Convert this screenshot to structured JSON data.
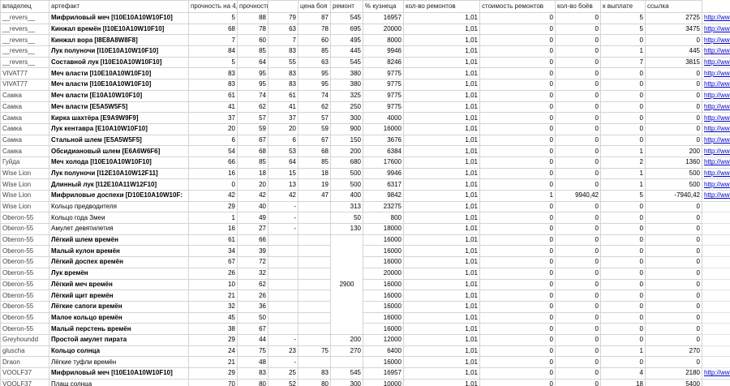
{
  "headers": [
    "владелец",
    "артефакт",
    "прочность на 4,09 22:2",
    "прочность на",
    "",
    "цена боя",
    "ремонт",
    "% кузнеца",
    "кол-во ремонтов",
    "стоимость ремонтов",
    "кол-во боёв",
    "к выплате",
    "ссылка"
  ],
  "merged_price": "2900",
  "rows": [
    {
      "owner": "__revers__",
      "art": "Мифриловый меч [I10E10A10W10F10]",
      "bold": true,
      "d1": "5",
      "d2": "88",
      "p1": "79",
      "p2": "87",
      "price": "545",
      "repair": "16957",
      "pct": "1,01",
      "nrep": "0",
      "cost": "0",
      "fights": "5",
      "pay": "2725",
      "link": "http://www.heroeswm"
    },
    {
      "owner": "__revers__",
      "art": "Кинжал времён [I10E10A10W10F10]",
      "bold": true,
      "d1": "68",
      "d2": "78",
      "p1": "63",
      "p2": "78",
      "price": "695",
      "repair": "20000",
      "pct": "1,01",
      "nrep": "0",
      "cost": "0",
      "fights": "5",
      "pay": "3475",
      "link": "http://www.heroeswm"
    },
    {
      "owner": "__revers__",
      "art": "Кинжал вора [I8E8A8W8F8]",
      "bold": true,
      "d1": "7",
      "d2": "60",
      "p1": "7",
      "p2": "60",
      "price": "495",
      "repair": "8000",
      "pct": "1,01",
      "nrep": "0",
      "cost": "0",
      "fights": "0",
      "pay": "0",
      "link": "http://www.heroeswm"
    },
    {
      "owner": "__revers__",
      "art": "Лук полуночи [I10E10A10W10F10]",
      "bold": true,
      "d1": "84",
      "d2": "85",
      "p1": "83",
      "p2": "85",
      "price": "445",
      "repair": "9946",
      "pct": "1,01",
      "nrep": "0",
      "cost": "0",
      "fights": "1",
      "pay": "445",
      "link": "http://www.heroeswm"
    },
    {
      "owner": "__revers__",
      "art": "Составной лук [I10E10A10W10F10]",
      "bold": true,
      "d1": "5",
      "d2": "64",
      "p1": "55",
      "p2": "63",
      "price": "545",
      "repair": "8246",
      "pct": "1,01",
      "nrep": "0",
      "cost": "0",
      "fights": "7",
      "pay": "3815",
      "link": "http://www.heroeswm"
    },
    {
      "owner": "VIVAT77",
      "art": "Меч власти [I10E10A10W10F10]",
      "bold": true,
      "d1": "83",
      "d2": "95",
      "p1": "83",
      "p2": "95",
      "price": "380",
      "repair": "9775",
      "pct": "1,01",
      "nrep": "0",
      "cost": "0",
      "fights": "0",
      "pay": "0",
      "link": "http://www.heroeswm"
    },
    {
      "owner": "VIVAT77",
      "art": "Меч власти [I10E10A10W10F10]",
      "bold": true,
      "d1": "83",
      "d2": "95",
      "p1": "83",
      "p2": "95",
      "price": "380",
      "repair": "9775",
      "pct": "1,01",
      "nrep": "0",
      "cost": "0",
      "fights": "0",
      "pay": "0",
      "link": "http://www.heroeswm"
    },
    {
      "owner": "Самка",
      "art": "Меч власти [E10A10W10F10]",
      "bold": true,
      "d1": "61",
      "d2": "74",
      "p1": "61",
      "p2": "74",
      "price": "325",
      "repair": "9775",
      "pct": "1,01",
      "nrep": "0",
      "cost": "0",
      "fights": "0",
      "pay": "0",
      "link": "http://www.heroeswm"
    },
    {
      "owner": "Самка",
      "art": "Меч власти [E5A5W5F5]",
      "bold": true,
      "d1": "41",
      "d2": "62",
      "p1": "41",
      "p2": "62",
      "price": "250",
      "repair": "9775",
      "pct": "1,01",
      "nrep": "0",
      "cost": "0",
      "fights": "0",
      "pay": "0",
      "link": "http://www.heroeswm"
    },
    {
      "owner": "Самка",
      "art": "Кирка шахтёра [E9A9W9F9]",
      "bold": true,
      "d1": "37",
      "d2": "57",
      "p1": "37",
      "p2": "57",
      "price": "300",
      "repair": "4000",
      "pct": "1,01",
      "nrep": "0",
      "cost": "0",
      "fights": "0",
      "pay": "0",
      "link": "http://www.heroeswm"
    },
    {
      "owner": "Самка",
      "art": "Лук кентавра [E10A10W10F10]",
      "bold": true,
      "d1": "20",
      "d2": "59",
      "p1": "20",
      "p2": "59",
      "price": "900",
      "repair": "16000",
      "pct": "1,01",
      "nrep": "0",
      "cost": "0",
      "fights": "0",
      "pay": "0",
      "link": "http://www.heroeswm"
    },
    {
      "owner": "Самка",
      "art": "Стальной шлем [E5A5W5F5]",
      "bold": true,
      "d1": "6",
      "d2": "67",
      "p1": "6",
      "p2": "67",
      "price": "150",
      "repair": "3676",
      "pct": "1,01",
      "nrep": "0",
      "cost": "0",
      "fights": "0",
      "pay": "0",
      "link": "http://www.heroeswm"
    },
    {
      "owner": "Самка",
      "art": "Обсидиановый шлем [E6A6W6F6]",
      "bold": true,
      "d1": "54",
      "d2": "68",
      "p1": "53",
      "p2": "68",
      "price": "200",
      "repair": "6384",
      "pct": "1,01",
      "nrep": "0",
      "cost": "0",
      "fights": "1",
      "pay": "200",
      "link": "http://www.heroeswm"
    },
    {
      "owner": "Гуйда",
      "art": "Меч холода [I10E10A10W10F10]",
      "bold": true,
      "d1": "66",
      "d2": "85",
      "p1": "64",
      "p2": "85",
      "price": "680",
      "repair": "17600",
      "pct": "1,01",
      "nrep": "0",
      "cost": "0",
      "fights": "2",
      "pay": "1360",
      "link": "http://www.heroeswm"
    },
    {
      "owner": "Wise Lion",
      "art": "Лук полуночи [I12E10A10W12F11]",
      "bold": true,
      "d1": "16",
      "d2": "18",
      "p1": "15",
      "p2": "18",
      "price": "500",
      "repair": "9946",
      "pct": "1,01",
      "nrep": "0",
      "cost": "0",
      "fights": "1",
      "pay": "500",
      "link": "http://www.heroeswm"
    },
    {
      "owner": "Wise Lion",
      "art": "Длинный лук [I12E10A11W12F10]",
      "bold": true,
      "d1": "0",
      "d2": "20",
      "p1": "13",
      "p2": "19",
      "price": "500",
      "repair": "6317",
      "pct": "1,01",
      "nrep": "0",
      "cost": "0",
      "fights": "1",
      "pay": "500",
      "link": "http://www.heroeswm"
    },
    {
      "owner": "Wise Lion",
      "art": "Мифриловые доспехи [D10E10A10W10F:",
      "bold": true,
      "d1": "42",
      "d2": "42",
      "p1": "42",
      "p2": "47",
      "price": "400",
      "repair": "9842",
      "pct": "1,01",
      "nrep": "1",
      "cost": "9940,42",
      "fights": "5",
      "pay": "-7940,42",
      "link": "http://www.heroeswm"
    },
    {
      "owner": "Wise Lion",
      "art": "Кольцо предводителя",
      "bold": false,
      "d1": "29",
      "d2": "40",
      "p1": "-",
      "p2": "",
      "price": "313",
      "repair": "23275",
      "pct": "1,01",
      "nrep": "0",
      "cost": "0",
      "fights": "0",
      "pay": "0",
      "link": ""
    },
    {
      "owner": "Oberon-55",
      "art": "Кольцо года Змеи",
      "bold": false,
      "d1": "1",
      "d2": "49",
      "p1": "-",
      "p2": "",
      "price": "50",
      "repair": "800",
      "pct": "1,01",
      "nrep": "0",
      "cost": "0",
      "fights": "0",
      "pay": "0",
      "link": ""
    },
    {
      "owner": "Oberon-55",
      "art": "Амулет девятилетия",
      "bold": false,
      "d1": "16",
      "d2": "27",
      "p1": "-",
      "p2": "",
      "price": "130",
      "repair": "18000",
      "pct": "1,01",
      "nrep": "0",
      "cost": "0",
      "fights": "0",
      "pay": "0",
      "link": ""
    },
    {
      "owner": "Oberon-55",
      "art": "Лёгкий шлем времён",
      "bold": true,
      "d1": "61",
      "d2": "66",
      "p1": "",
      "p2": "",
      "price": "",
      "repair": "16000",
      "pct": "1,01",
      "nrep": "0",
      "cost": "0",
      "fights": "0",
      "pay": "0",
      "link": ""
    },
    {
      "owner": "Oberon-55",
      "art": "Малый кулон времён",
      "bold": true,
      "d1": "34",
      "d2": "39",
      "p1": "",
      "p2": "",
      "price": "",
      "repair": "16000",
      "pct": "1,01",
      "nrep": "0",
      "cost": "0",
      "fights": "0",
      "pay": "0",
      "link": ""
    },
    {
      "owner": "Oberon-55",
      "art": "Лёгкий доспех времён",
      "bold": true,
      "d1": "67",
      "d2": "72",
      "p1": "",
      "p2": "",
      "price": "",
      "repair": "16000",
      "pct": "1,01",
      "nrep": "0",
      "cost": "0",
      "fights": "0",
      "pay": "0",
      "link": ""
    },
    {
      "owner": "Oberon-55",
      "art": "Лук времён",
      "bold": true,
      "d1": "26",
      "d2": "32",
      "p1": "",
      "p2": "",
      "price": "",
      "repair": "20000",
      "pct": "1,01",
      "nrep": "0",
      "cost": "0",
      "fights": "0",
      "pay": "0",
      "link": ""
    },
    {
      "owner": "Oberon-55",
      "art": "Лёгкий меч времён",
      "bold": true,
      "d1": "10",
      "d2": "62",
      "p1": "",
      "p2": "",
      "price": "",
      "repair": "16000",
      "pct": "1,01",
      "nrep": "0",
      "cost": "0",
      "fights": "0",
      "pay": "0",
      "link": ""
    },
    {
      "owner": "Oberon-55",
      "art": "Лёгкий щит времён",
      "bold": true,
      "d1": "21",
      "d2": "26",
      "p1": "",
      "p2": "",
      "price": "",
      "repair": "16000",
      "pct": "1,01",
      "nrep": "0",
      "cost": "0",
      "fights": "0",
      "pay": "0",
      "link": ""
    },
    {
      "owner": "Oberon-55",
      "art": "Лёгкие сапоги времён",
      "bold": true,
      "d1": "32",
      "d2": "36",
      "p1": "",
      "p2": "",
      "price": "",
      "repair": "16000",
      "pct": "1,01",
      "nrep": "0",
      "cost": "0",
      "fights": "0",
      "pay": "0",
      "link": ""
    },
    {
      "owner": "Oberon-55",
      "art": "Малое кольцо времён",
      "bold": true,
      "d1": "45",
      "d2": "50",
      "p1": "",
      "p2": "",
      "price": "",
      "repair": "16000",
      "pct": "1,01",
      "nrep": "0",
      "cost": "0",
      "fights": "0",
      "pay": "0",
      "link": ""
    },
    {
      "owner": "Oberon-55",
      "art": "Малый перстень времён",
      "bold": true,
      "d1": "38",
      "d2": "67",
      "p1": "",
      "p2": "",
      "price": "",
      "repair": "16000",
      "pct": "1,01",
      "nrep": "0",
      "cost": "0",
      "fights": "0",
      "pay": "0",
      "link": ""
    },
    {
      "owner": "Greyhoundd",
      "art": "Простой амулет пирата",
      "bold": true,
      "d1": "29",
      "d2": "44",
      "p1": "-",
      "p2": "",
      "price": "200",
      "repair": "12000",
      "pct": "1,01",
      "nrep": "0",
      "cost": "0",
      "fights": "0",
      "pay": "0",
      "link": ""
    },
    {
      "owner": "gluscha",
      "art": "Кольцо солнца",
      "bold": true,
      "d1": "24",
      "d2": "75",
      "p1": "23",
      "p2": "75",
      "price": "270",
      "repair": "6400",
      "pct": "1,01",
      "nrep": "0",
      "cost": "0",
      "fights": "1",
      "pay": "270",
      "link": ""
    },
    {
      "owner": "Draon",
      "art": "Лёгкие туфли времён",
      "bold": false,
      "d1": "21",
      "d2": "48",
      "p1": "-",
      "p2": "",
      "price": "",
      "repair": "16000",
      "pct": "1,01",
      "nrep": "0",
      "cost": "0",
      "fights": "0",
      "pay": "0",
      "link": ""
    },
    {
      "owner": "VOOLF37",
      "art": "Мифриловый меч [I10E10A10W10F10]",
      "bold": true,
      "d1": "29",
      "d2": "83",
      "p1": "25",
      "p2": "83",
      "price": "545",
      "repair": "16957",
      "pct": "1,01",
      "nrep": "0",
      "cost": "0",
      "fights": "4",
      "pay": "2180",
      "link": "http://www.heroeswm"
    },
    {
      "owner": "VOOLF37",
      "art": "Плащ солнца",
      "bold": false,
      "d1": "70",
      "d2": "80",
      "p1": "52",
      "p2": "80",
      "price": "300",
      "repair": "10000",
      "pct": "1,01",
      "nrep": "0",
      "cost": "0",
      "fights": "18",
      "pay": "5400",
      "link": ""
    }
  ]
}
